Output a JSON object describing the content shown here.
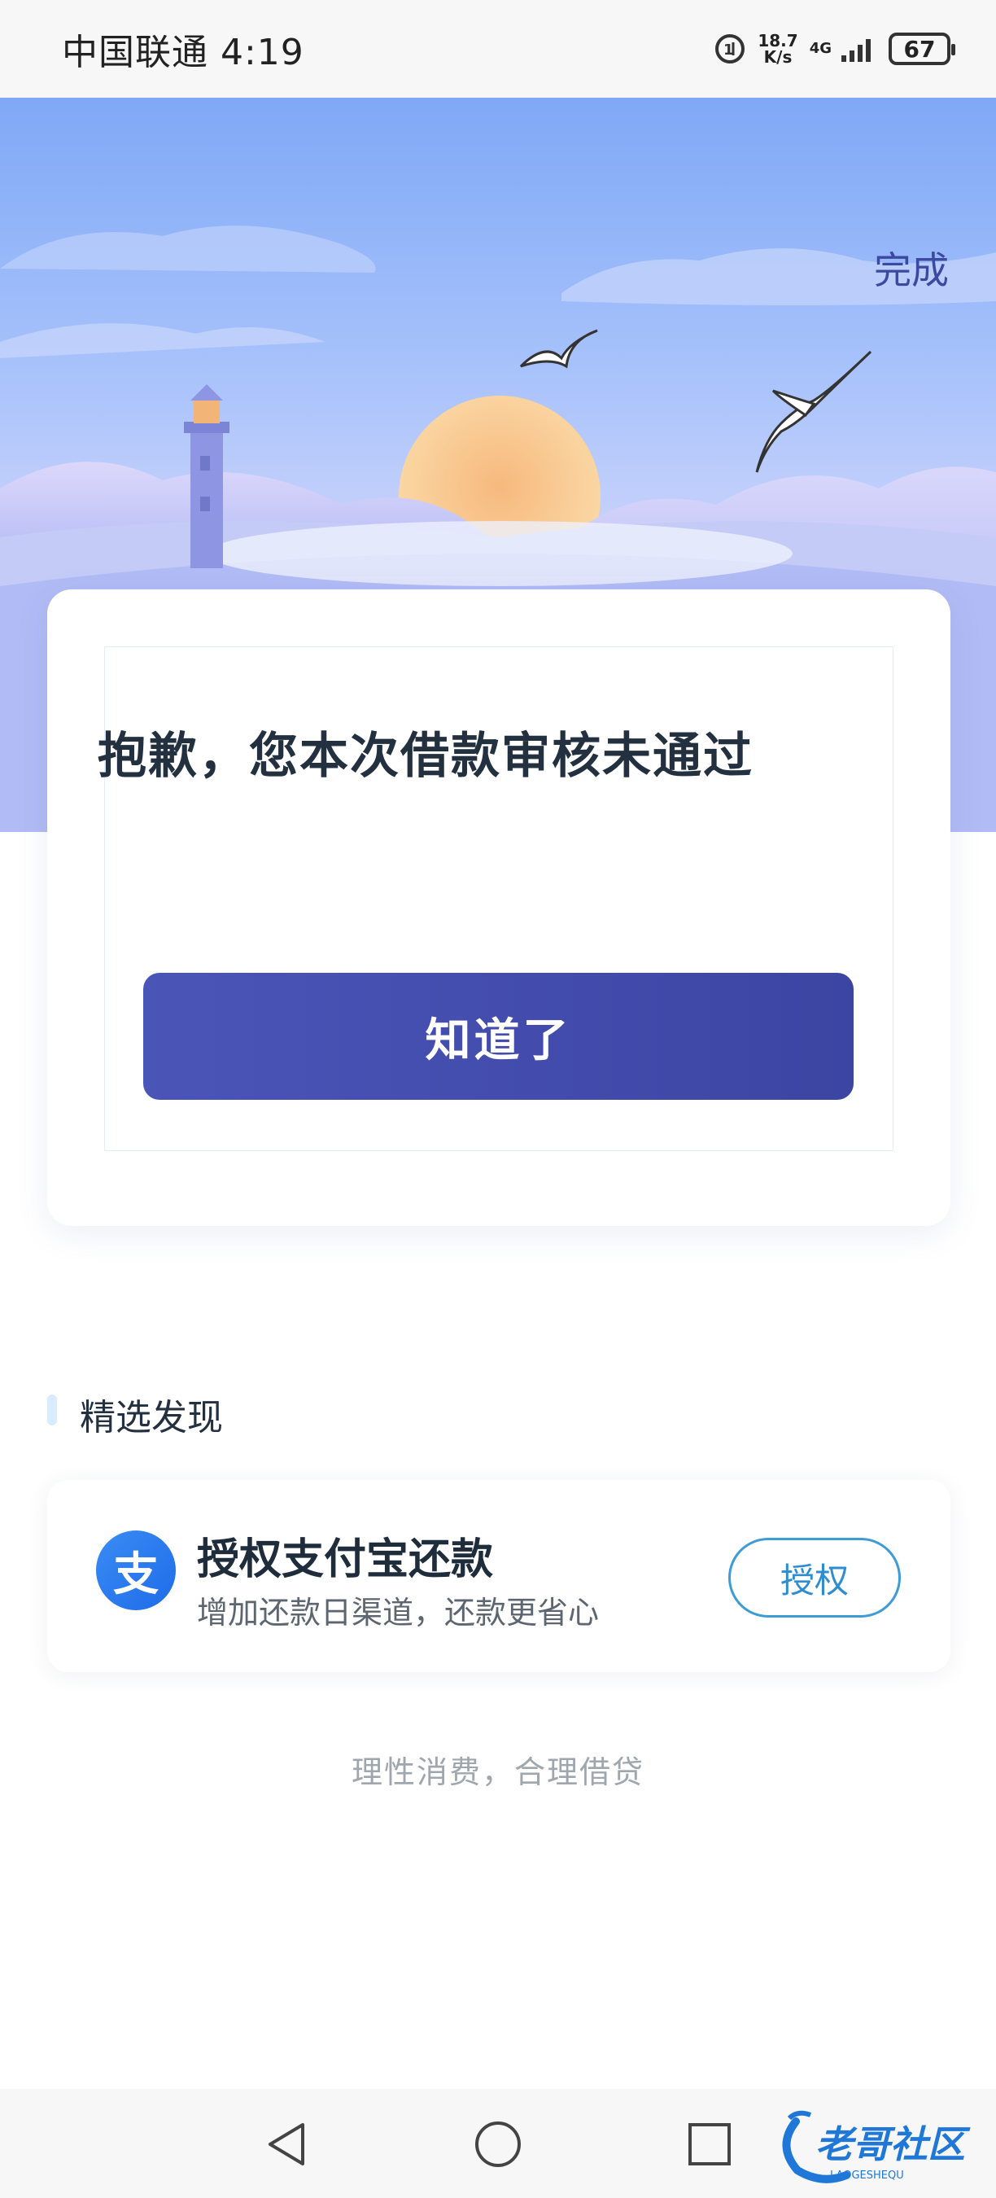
{
  "status_bar": {
    "carrier_time": "中国联通 4:19",
    "speed_value": "18.7",
    "speed_unit": "K/s",
    "network": "4G",
    "battery": "67"
  },
  "hero": {
    "done_label": "完成"
  },
  "result_card": {
    "title": "抱歉，您本次借款审核未通过",
    "ok_label": "知道了"
  },
  "featured": {
    "section_title": "精选发现",
    "promo": {
      "title": "授权支付宝还款",
      "subtitle": "增加还款日渠道，还款更省心",
      "button_label": "授权",
      "icon_char": "支"
    }
  },
  "footer_note": "理性消费，合理借贷",
  "watermark": {
    "text": "老哥社区",
    "subtext": "LAOGESHEQU"
  },
  "colors": {
    "primary": "#4a55b8",
    "link": "#2d8dd0",
    "alipay": "#1f6ce8"
  }
}
